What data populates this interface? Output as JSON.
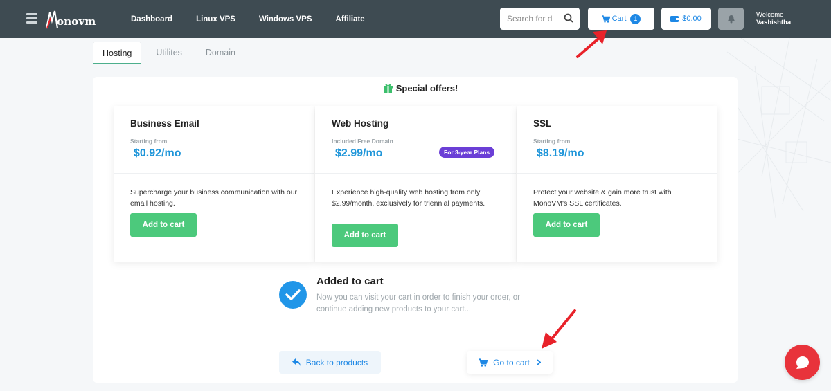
{
  "header": {
    "logo_text": "onovm",
    "nav": [
      "Dashboard",
      "Linux VPS",
      "Windows VPS",
      "Affiliate"
    ],
    "search_placeholder": "Search for d",
    "cart_label": "Cart",
    "cart_count": "1",
    "balance": "$0.00",
    "welcome_label": "Welcome",
    "user_name": "Vashishtha"
  },
  "tabs": [
    "Hosting",
    "Utilites",
    "Domain"
  ],
  "offers": {
    "title": "Special offers!",
    "cards": [
      {
        "title": "Business Email",
        "label": "Starting from",
        "price": "$0.92/mo",
        "badge": "",
        "description": "Supercharge your business communication with our email hosting.",
        "button": "Add to cart"
      },
      {
        "title": "Web Hosting",
        "label": "Included Free Domain",
        "price": "$2.99/mo",
        "badge": "For 3-year Plans",
        "description": "Experience high-quality web hosting from only $2.99/month, exclusively for triennial payments.",
        "button": "Add to cart"
      },
      {
        "title": "SSL",
        "label": "Starting from",
        "price": "$8.19/mo",
        "badge": "",
        "description": "Protect your website & gain more trust with MonoVM's SSL certificates.",
        "button": "Add to cart"
      }
    ]
  },
  "added": {
    "title": "Added to cart",
    "text": "Now you can visit your cart in order to finish your order, or continue adding new products to your cart..."
  },
  "actions": {
    "back": "Back to products",
    "goto": "Go to cart"
  },
  "colors": {
    "topbar": "#3e4b52",
    "accent_blue": "#1e88e5",
    "price_blue": "#1e95d9",
    "green": "#4cc97c",
    "badge_purple": "#6b3fd6",
    "arrow_red": "#e8222a",
    "chat_red": "#e8333b"
  }
}
